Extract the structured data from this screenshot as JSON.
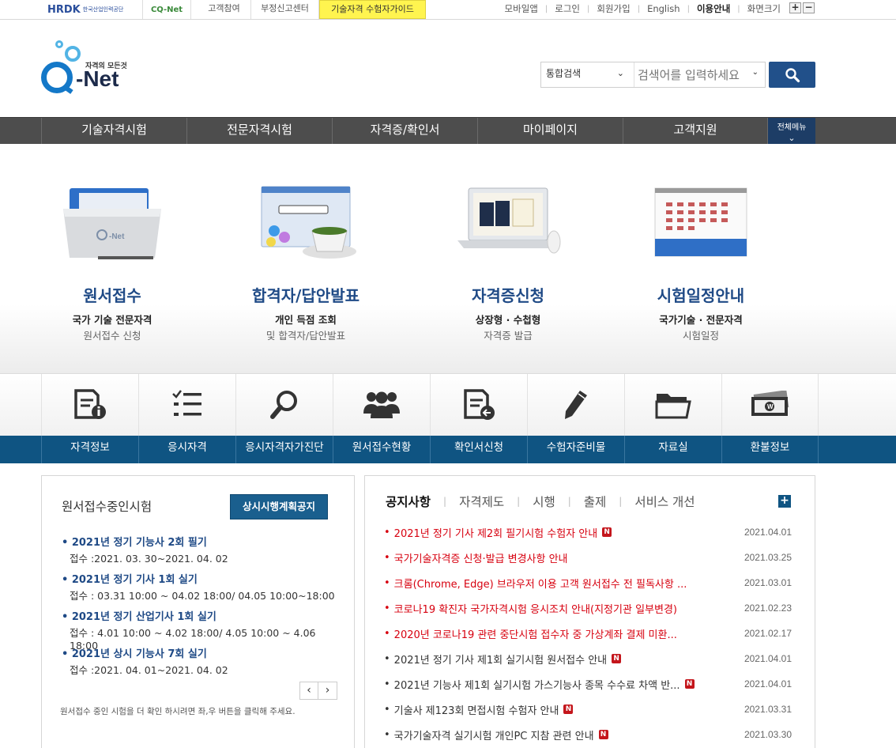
{
  "topbar": {
    "hrdk": "HRDK",
    "hrdk_sub": "한국산업인력공단",
    "cqnet": "CQ-Net",
    "links": [
      "고객참여",
      "부정신고센터",
      "기술자격 수험자가이드"
    ],
    "right_links": [
      "모바일앱",
      "로그인",
      "회원가입",
      "English",
      "이용안내",
      "화면크기"
    ],
    "zoom_in": "+",
    "zoom_out": "−"
  },
  "header": {
    "logo_slogan": "자격의 모든것",
    "logo_text": "-Net",
    "search": {
      "scope": "통합검색",
      "placeholder": "검색어를 입력하세요"
    }
  },
  "gnb": {
    "items": [
      "기술자격시험",
      "전문자격시험",
      "자격증/확인서",
      "마이페이지",
      "고객지원"
    ],
    "all_menu": "전체메뉴"
  },
  "visual": [
    {
      "title": "원서접수",
      "sub1": "국가 기술 전문자격",
      "sub2": "원서접수 신청"
    },
    {
      "title": "합격자/답안발표",
      "sub1": "개인 득점 조회",
      "sub2": "및 합격자/답안발표"
    },
    {
      "title": "자격증신청",
      "sub1": "상장형 · 수첩형",
      "sub2": "자격증 발급"
    },
    {
      "title": "시험일정안내",
      "sub1": "국가기술 · 전문자격",
      "sub2": "시험일정"
    }
  ],
  "quick_menu": [
    {
      "label": "자격정보",
      "icon": "doc-info-icon"
    },
    {
      "label": "응시자격",
      "icon": "checklist-icon"
    },
    {
      "label": "응시자격자가진단",
      "icon": "magnifier-icon"
    },
    {
      "label": "원서접수현황",
      "icon": "people-icon"
    },
    {
      "label": "확인서신청",
      "icon": "doc-return-icon"
    },
    {
      "label": "수험자준비물",
      "icon": "pencil-icon"
    },
    {
      "label": "자료실",
      "icon": "folder-icon"
    },
    {
      "label": "환불정보",
      "icon": "money-icon"
    }
  ],
  "exam_box": {
    "title": "원서접수중인시험",
    "plan_button": "상시시행계획공지",
    "items": [
      {
        "title": "2021년 정기 기능사 2회 필기",
        "date": "접수 :2021. 03. 30~2021. 04. 02"
      },
      {
        "title": "2021년 정기 기사 1회 실기",
        "date": "접수 : 03.31 10:00 ~ 04.02 18:00/ 04.05 10:00~18:00"
      },
      {
        "title": "2021년 정기 산업기사 1회 실기",
        "date": "접수 : 4.01 10:00 ~ 4.02 18:00/ 4.05 10:00 ~ 4.06 18:00"
      },
      {
        "title": "2021년 상시 기능사 7회 실기",
        "date": "접수 :2021. 04. 01~2021. 04. 02"
      }
    ],
    "prev": "‹",
    "next": "›",
    "note": "원서접수 중인 시험을 더 확인 하시려면 좌,우 버튼을 클릭해 주세요."
  },
  "notice_box": {
    "tabs": [
      "공지사항",
      "자격제도",
      "시행",
      "출제",
      "서비스 개선"
    ],
    "plus": "+",
    "items": [
      {
        "text": "2021년 정기 기사 제2회 필기시험 수험자 안내",
        "new": true,
        "red": true,
        "date": "2021.04.01"
      },
      {
        "text": "국가기술자격증 신청·발급 변경사항 안내",
        "new": false,
        "red": true,
        "date": "2021.03.25"
      },
      {
        "text": "크롬(Chrome, Edge) 브라우저 이용 고객 원서접수 전 필독사항 ...",
        "new": false,
        "red": true,
        "date": "2021.03.01"
      },
      {
        "text": "코로나19 확진자 국가자격시험 응시조치 안내(지정기관 일부변경)",
        "new": false,
        "red": true,
        "date": "2021.02.23"
      },
      {
        "text": "2020년 코로나19 관련 중단시험 접수자 중 가상계좌 결제 미환...",
        "new": false,
        "red": true,
        "date": "2021.02.17"
      },
      {
        "text": "2021년 정기 기사 제1회 실기시험 원서접수 안내",
        "new": true,
        "red": false,
        "date": "2021.04.01"
      },
      {
        "text": "2021년 기능사 제1회 실기시험 가스기능사 종목 수수료 차액 반...",
        "new": true,
        "red": false,
        "date": "2021.04.01"
      },
      {
        "text": "기술사 제123회 면접시험 수험자 안내",
        "new": true,
        "red": false,
        "date": "2021.03.31"
      },
      {
        "text": "국가기술자격 실기시험 개인PC 지참 관련 안내",
        "new": true,
        "red": false,
        "date": "2021.03.30"
      }
    ],
    "new_label": "N"
  }
}
